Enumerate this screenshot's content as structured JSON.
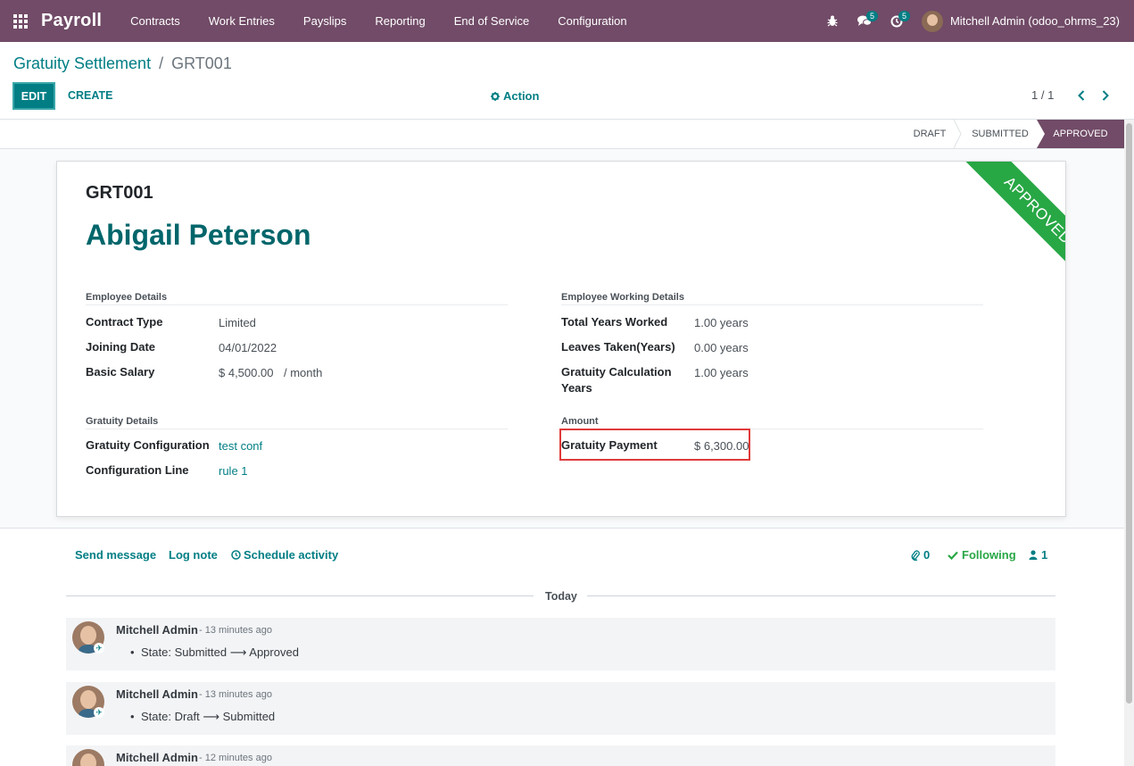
{
  "navbar": {
    "brand": "Payroll",
    "menu": [
      "Contracts",
      "Work Entries",
      "Payslips",
      "Reporting",
      "End of Service",
      "Configuration"
    ],
    "messages_count": "5",
    "activities_count": "5",
    "user": "Mitchell Admin (odoo_ohrms_23)",
    "color": "#714b67"
  },
  "breadcrumb": {
    "parent": "Gratuity Settlement",
    "separator": "/",
    "current": "GRT001"
  },
  "toolbar": {
    "edit": "EDIT",
    "create": "CREATE",
    "action": "Action",
    "pager": "1 / 1"
  },
  "statusbar": {
    "stages": [
      "DRAFT",
      "SUBMITTED",
      "APPROVED"
    ],
    "active": "APPROVED"
  },
  "record": {
    "ribbon": "APPROVED",
    "reference": "GRT001",
    "employee": "Abigail Peterson",
    "employee_details": {
      "title": "Employee Details",
      "contract_type_label": "Contract Type",
      "contract_type": "Limited",
      "joining_date_label": "Joining Date",
      "joining_date": "04/01/2022",
      "basic_salary_label": "Basic Salary",
      "basic_salary": "$ 4,500.00",
      "salary_period": "/ month"
    },
    "working_details": {
      "title": "Employee Working Details",
      "total_years_label": "Total Years Worked",
      "total_years": "1.00 years",
      "leaves_label": "Leaves Taken(Years)",
      "leaves": "0.00 years",
      "calc_years_label_1": "Gratuity Calculation",
      "calc_years_label_2": "Years",
      "calc_years": "1.00 years"
    },
    "gratuity_details": {
      "title": "Gratuity Details",
      "config_label": "Gratuity Configuration",
      "config": "test conf",
      "line_label": "Configuration Line",
      "line": "rule 1"
    },
    "amount": {
      "title": "Amount",
      "payment_label": "Gratuity Payment",
      "payment": "$ 6,300.00"
    }
  },
  "chatter": {
    "send_message": "Send message",
    "log_note": "Log note",
    "schedule_activity": "Schedule activity",
    "attachments": "0",
    "following": "Following",
    "followers": "1",
    "date_separator": "Today",
    "messages": [
      {
        "author": "Mitchell Admin",
        "time": "- 13 minutes ago",
        "from": "State: Submitted",
        "to": "Approved"
      },
      {
        "author": "Mitchell Admin",
        "time": "- 13 minutes ago",
        "from": "State: Draft",
        "to": "Submitted"
      },
      {
        "author": "Mitchell Admin",
        "time": "- 12 minutes ago"
      }
    ]
  }
}
